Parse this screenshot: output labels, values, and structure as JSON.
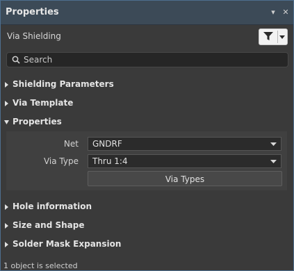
{
  "panel": {
    "title": "Properties",
    "pin_glyph": "▾",
    "close_glyph": "✕"
  },
  "mode": {
    "label": "Via Shielding"
  },
  "search": {
    "placeholder": "Search",
    "value": ""
  },
  "sections": [
    {
      "label": "Shielding Parameters",
      "expanded": false
    },
    {
      "label": "Via Template",
      "expanded": false
    },
    {
      "label": "Properties",
      "expanded": true
    },
    {
      "label": "Hole information",
      "expanded": false
    },
    {
      "label": "Size and Shape",
      "expanded": false
    },
    {
      "label": "Solder Mask Expansion",
      "expanded": false
    }
  ],
  "properties": {
    "net_label": "Net",
    "net_value": "GNDRF",
    "via_type_label": "Via Type",
    "via_type_value": "Thru 1:4",
    "via_types_button": "Via Types"
  },
  "status": {
    "text": "1 object is selected"
  },
  "colors": {
    "title_bar": "#3c4a57",
    "panel_bg": "#3a3a3a",
    "accent_border": "#4e6f8f",
    "input_bg": "#2b2b2b"
  },
  "icons": {
    "filter": "funnel-icon",
    "search": "magnifier-icon",
    "collapsed": "triangle-right-icon",
    "expanded": "triangle-down-icon"
  }
}
